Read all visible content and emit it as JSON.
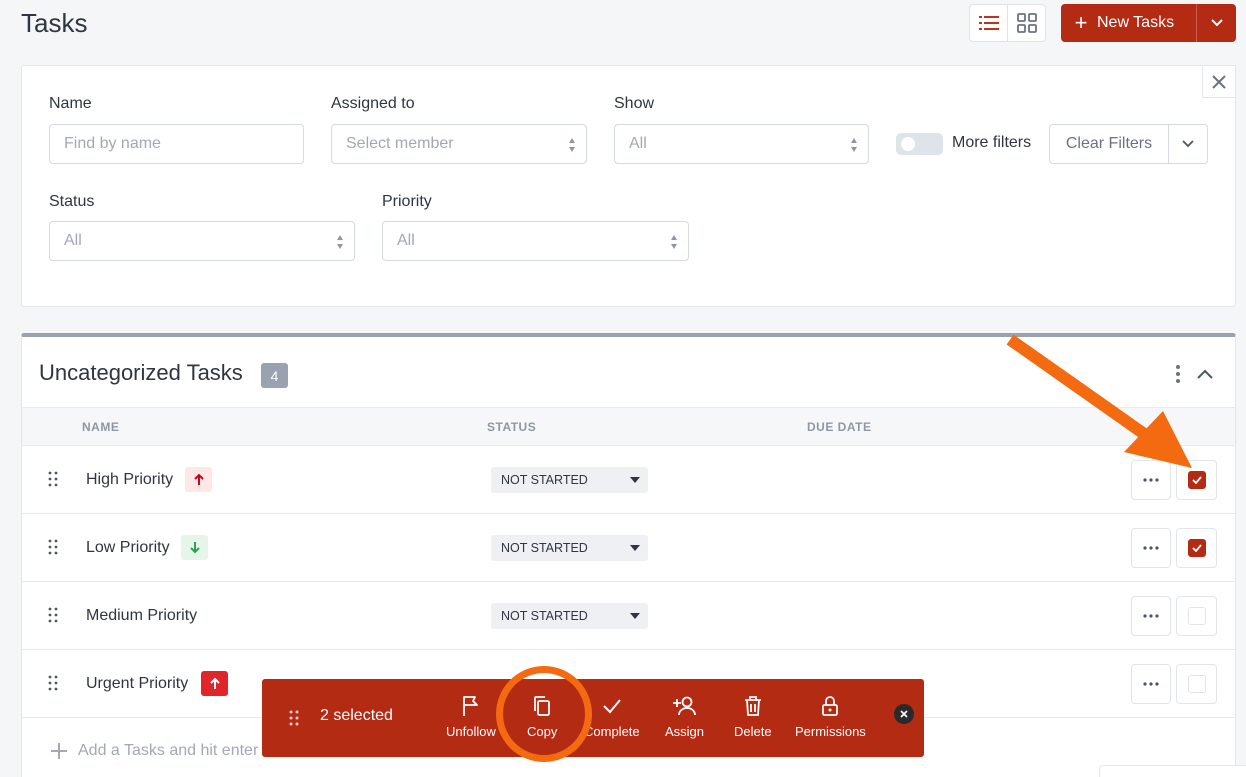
{
  "page": {
    "title": "Tasks"
  },
  "header": {
    "new_label": "New Tasks"
  },
  "filters": {
    "name_label": "Name",
    "name_placeholder": "Find by name",
    "assigned_label": "Assigned to",
    "assigned_value": "Select member",
    "show_label": "Show",
    "show_value": "All",
    "more_filters_label": "More filters",
    "more_filters_on": false,
    "clear_label": "Clear Filters",
    "status_label": "Status",
    "status_value": "All",
    "priority_label": "Priority",
    "priority_value": "All"
  },
  "group": {
    "title": "Uncategorized Tasks",
    "count": "4",
    "columns": [
      "NAME",
      "STATUS",
      "DUE DATE"
    ],
    "tasks": [
      {
        "name": "High Priority",
        "priority": "high",
        "status": "NOT STARTED",
        "checked": true
      },
      {
        "name": "Low Priority",
        "priority": "low",
        "status": "NOT STARTED",
        "checked": true
      },
      {
        "name": "Medium Priority",
        "priority": "medium",
        "status": "NOT STARTED",
        "checked": false
      },
      {
        "name": "Urgent Priority",
        "priority": "urgent",
        "status": "NOT STARTED",
        "checked": false
      }
    ],
    "add_placeholder": "Add a Tasks and hit enter / return"
  },
  "bulk_bar": {
    "selected_label": "2 selected",
    "actions": [
      {
        "label": "Unfollow",
        "icon": "flag-icon"
      },
      {
        "label": "Copy",
        "icon": "copy-icon"
      },
      {
        "label": "Complete",
        "icon": "check-icon"
      },
      {
        "label": "Assign",
        "icon": "user-plus-icon"
      },
      {
        "label": "Delete",
        "icon": "trash-icon"
      },
      {
        "label": "Permissions",
        "icon": "lock-icon"
      }
    ]
  },
  "colors": {
    "accent": "#b42b14",
    "annotation": "#f36a10",
    "high": "#d0021b",
    "low": "#2e9e4f",
    "urgent": "#e0262b"
  }
}
